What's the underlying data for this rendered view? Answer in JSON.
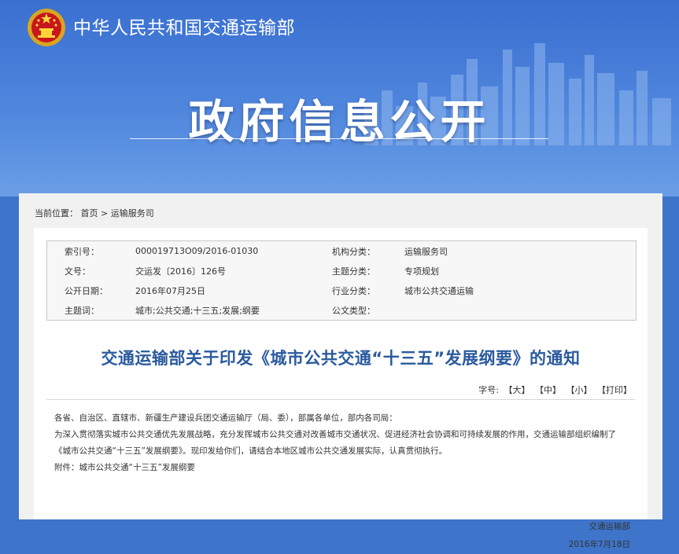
{
  "header": {
    "ministry": "中华人民共和国交通运输部",
    "banner_title": "政府信息公开"
  },
  "breadcrumb": {
    "prefix": "当前位置：",
    "home": "首页",
    "sep": ">",
    "current": "运输服务司"
  },
  "meta": {
    "rows": [
      {
        "k1": "索引号：",
        "v1": "000019713O09/2016-01030",
        "k2": "机构分类：",
        "v2": "运输服务司"
      },
      {
        "k1": "文号：",
        "v1": "交运发〔2016〕126号",
        "k2": "主题分类：",
        "v2": "专项规划"
      },
      {
        "k1": "公开日期：",
        "v1": "2016年07月25日",
        "k2": "行业分类：",
        "v2": "城市公共交通运输"
      },
      {
        "k1": "主题词：",
        "v1": "城市;公共交通;十三五;发展;纲要",
        "k2": "公文类型：",
        "v2": ""
      }
    ]
  },
  "doc": {
    "title": "交通运输部关于印发《城市公共交通“十三五”发展纲要》的通知",
    "fontsize_label": "字号:",
    "size_large": "【大】",
    "size_medium": "【中】",
    "size_small": "【小】",
    "print": "【打印】",
    "para1": "各省、自治区、直辖市、新疆生产建设兵团交通运输厅（局、委），部属各单位，部内各司局：",
    "para2": "为深入贯彻落实城市公共交通优先发展战略，充分发挥城市公共交通对改善城市交通状况、促进经济社会协调和可持续发展的作用，交通运输部组织编制了《城市公共交通“十三五”发展纲要》。现印发给你们，请结合本地区城市公共交通发展实际，认真贯彻执行。",
    "attachment": "附件：城市公共交通“十三五”发展纲要",
    "signer": "交通运输部",
    "date": "2016年7月18日"
  },
  "colors": {
    "banner": "#3a6fd0",
    "title_blue": "#2a5a9e",
    "panel_bg": "#f1f1f1"
  }
}
